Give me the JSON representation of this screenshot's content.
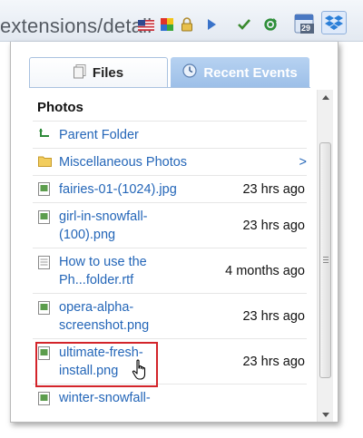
{
  "toolbar": {
    "url_fragment": "extensions/detail",
    "icons": [
      "flag-icon",
      "color-squares-icon",
      "lock-icon",
      "play-icon",
      "checkmark-icon",
      "refresh-icon",
      "calendar-icon",
      "dropbox-icon"
    ],
    "calendar_badge": "29"
  },
  "popup": {
    "tabs": [
      {
        "label": "Files",
        "icon": "files-icon",
        "active": true
      },
      {
        "label": "Recent Events",
        "icon": "clock-icon",
        "active": false
      }
    ],
    "section_title": "Photos",
    "items": [
      {
        "icon": "parent-folder-icon",
        "name": "Parent Folder",
        "meta": ""
      },
      {
        "icon": "folder-icon",
        "name": "Miscellaneous Photos",
        "meta": ">"
      },
      {
        "icon": "image-file-icon",
        "name": "fairies-01-(1024).jpg",
        "meta": "23 hrs ago"
      },
      {
        "icon": "image-file-icon",
        "name_line1": "girl-in-snowfall-",
        "name_line2": "(100).png",
        "meta": "23 hrs ago"
      },
      {
        "icon": "text-file-icon",
        "name_line1": "How to use the",
        "name_line2": "Ph...folder.rtf",
        "meta": "4 months ago"
      },
      {
        "icon": "image-file-icon",
        "name_line1": "opera-alpha-",
        "name_line2": "screenshot.png",
        "meta": "23 hrs ago"
      },
      {
        "icon": "image-file-icon",
        "name_line1": "ultimate-fresh-",
        "name_line2": "install.png",
        "meta": "23 hrs ago"
      },
      {
        "icon": "image-file-icon",
        "name_line1": "winter-snowfall-",
        "name_line2": "",
        "meta": ""
      }
    ]
  },
  "colors": {
    "link": "#2466b8",
    "highlight": "#d3242a",
    "active_tab_border": "#a9c2e0",
    "inactive_tab_bg": "#9cbfe8"
  }
}
